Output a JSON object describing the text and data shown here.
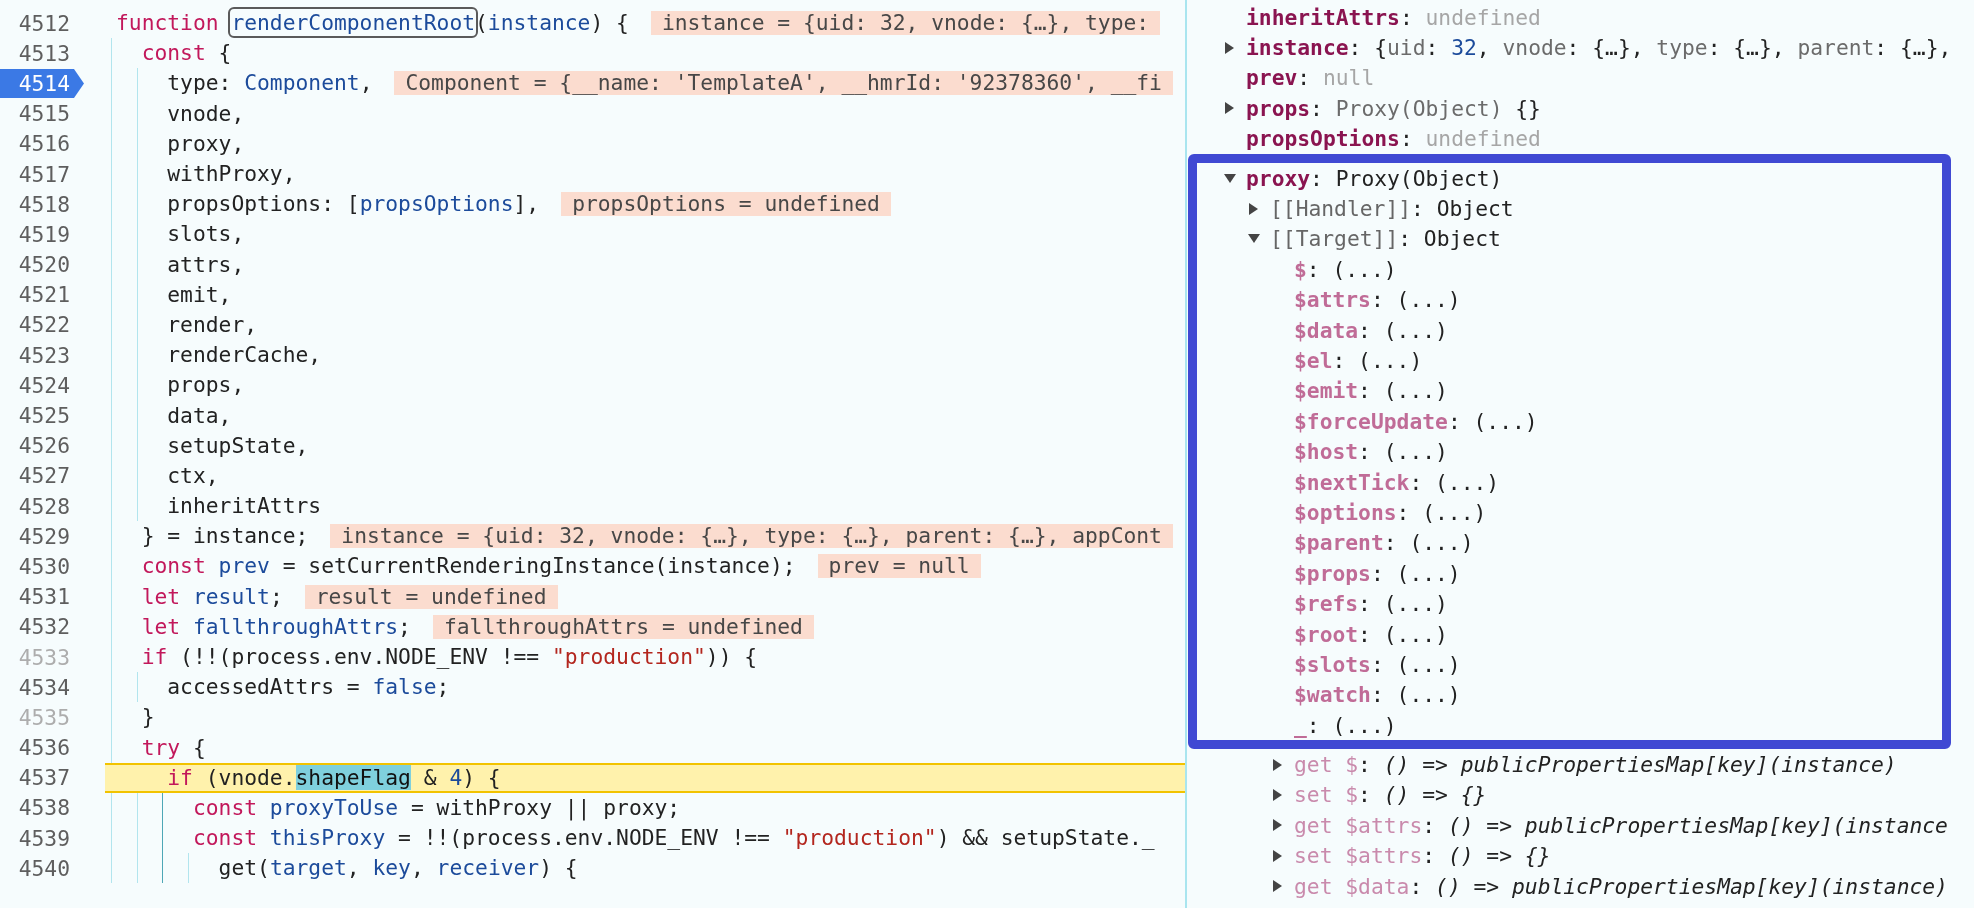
{
  "source": {
    "lines": [
      {
        "number": "4512",
        "breakpoint": false,
        "current": false,
        "dimmed": false,
        "tokens": [
          {
            "text": "function ",
            "kind": "keyword"
          },
          {
            "text": "renderComponentRoot",
            "kind": "outlined"
          },
          {
            "text": "(",
            "kind": "plain"
          },
          {
            "text": "instance",
            "kind": "ident"
          },
          {
            "text": ") {",
            "kind": "plain"
          }
        ],
        "value": "instance = {uid: 32, vnode: {…}, type:"
      },
      {
        "number": "4513",
        "breakpoint": false,
        "current": false,
        "dimmed": false,
        "tokens": [
          {
            "text": "  const",
            "kind": "keyword"
          },
          {
            "text": " {",
            "kind": "plain"
          }
        ]
      },
      {
        "number": "4514",
        "breakpoint": true,
        "current": false,
        "dimmed": false,
        "tokens": [
          {
            "text": "    type: ",
            "kind": "plain"
          },
          {
            "text": "Component",
            "kind": "ident"
          },
          {
            "text": ",",
            "kind": "plain"
          }
        ],
        "value": "Component = {__name: 'TemplateA', __hmrId: '92378360', __fi"
      },
      {
        "number": "4515",
        "breakpoint": false,
        "current": false,
        "dimmed": false,
        "tokens": [
          {
            "text": "    vnode,",
            "kind": "plain"
          }
        ]
      },
      {
        "number": "4516",
        "breakpoint": false,
        "current": false,
        "dimmed": false,
        "tokens": [
          {
            "text": "    proxy,",
            "kind": "plain"
          }
        ]
      },
      {
        "number": "4517",
        "breakpoint": false,
        "current": false,
        "dimmed": false,
        "tokens": [
          {
            "text": "    withProxy,",
            "kind": "plain"
          }
        ]
      },
      {
        "number": "4518",
        "breakpoint": false,
        "current": false,
        "dimmed": false,
        "tokens": [
          {
            "text": "    propsOptions: [",
            "kind": "plain"
          },
          {
            "text": "propsOptions",
            "kind": "ident"
          },
          {
            "text": "],",
            "kind": "plain"
          }
        ],
        "value": "propsOptions = undefined"
      },
      {
        "number": "4519",
        "breakpoint": false,
        "current": false,
        "dimmed": false,
        "tokens": [
          {
            "text": "    slots,",
            "kind": "plain"
          }
        ]
      },
      {
        "number": "4520",
        "breakpoint": false,
        "current": false,
        "dimmed": false,
        "tokens": [
          {
            "text": "    attrs,",
            "kind": "plain"
          }
        ]
      },
      {
        "number": "4521",
        "breakpoint": false,
        "current": false,
        "dimmed": false,
        "tokens": [
          {
            "text": "    emit,",
            "kind": "plain"
          }
        ]
      },
      {
        "number": "4522",
        "breakpoint": false,
        "current": false,
        "dimmed": false,
        "tokens": [
          {
            "text": "    render,",
            "kind": "plain"
          }
        ]
      },
      {
        "number": "4523",
        "breakpoint": false,
        "current": false,
        "dimmed": false,
        "tokens": [
          {
            "text": "    renderCache,",
            "kind": "plain"
          }
        ]
      },
      {
        "number": "4524",
        "breakpoint": false,
        "current": false,
        "dimmed": false,
        "tokens": [
          {
            "text": "    props,",
            "kind": "plain"
          }
        ]
      },
      {
        "number": "4525",
        "breakpoint": false,
        "current": false,
        "dimmed": false,
        "tokens": [
          {
            "text": "    data,",
            "kind": "plain"
          }
        ]
      },
      {
        "number": "4526",
        "breakpoint": false,
        "current": false,
        "dimmed": false,
        "tokens": [
          {
            "text": "    setupState,",
            "kind": "plain"
          }
        ]
      },
      {
        "number": "4527",
        "breakpoint": false,
        "current": false,
        "dimmed": false,
        "tokens": [
          {
            "text": "    ctx,",
            "kind": "plain"
          }
        ]
      },
      {
        "number": "4528",
        "breakpoint": false,
        "current": false,
        "dimmed": false,
        "tokens": [
          {
            "text": "    inheritAttrs",
            "kind": "plain"
          }
        ]
      },
      {
        "number": "4529",
        "breakpoint": false,
        "current": false,
        "dimmed": false,
        "tokens": [
          {
            "text": "  } = instance;",
            "kind": "plain"
          }
        ],
        "value": "instance = {uid: 32, vnode: {…}, type: {…}, parent: {…}, appCont"
      },
      {
        "number": "4530",
        "breakpoint": false,
        "current": false,
        "dimmed": false,
        "tokens": [
          {
            "text": "  const",
            "kind": "keyword"
          },
          {
            "text": " prev",
            "kind": "ident"
          },
          {
            "text": " = setCurrentRenderingInstance(instance);",
            "kind": "plain"
          }
        ],
        "value": "prev = null"
      },
      {
        "number": "4531",
        "breakpoint": false,
        "current": false,
        "dimmed": false,
        "tokens": [
          {
            "text": "  let",
            "kind": "keyword"
          },
          {
            "text": " result",
            "kind": "ident"
          },
          {
            "text": ";",
            "kind": "plain"
          }
        ],
        "value": "result = undefined"
      },
      {
        "number": "4532",
        "breakpoint": false,
        "current": false,
        "dimmed": false,
        "tokens": [
          {
            "text": "  let",
            "kind": "keyword"
          },
          {
            "text": " fallthroughAttrs",
            "kind": "ident"
          },
          {
            "text": ";",
            "kind": "plain"
          }
        ],
        "value": "fallthroughAttrs = undefined"
      },
      {
        "number": "4533",
        "breakpoint": false,
        "current": false,
        "dimmed": true,
        "tokens": [
          {
            "text": "  if",
            "kind": "keyword"
          },
          {
            "text": " (!!(process.env.NODE_ENV !== ",
            "kind": "plain"
          },
          {
            "text": "\"production\"",
            "kind": "string"
          },
          {
            "text": ")) {",
            "kind": "plain"
          }
        ]
      },
      {
        "number": "4534",
        "breakpoint": false,
        "current": false,
        "dimmed": false,
        "tokens": [
          {
            "text": "    accessedAttrs = ",
            "kind": "plain"
          },
          {
            "text": "false",
            "kind": "ident"
          },
          {
            "text": ";",
            "kind": "plain"
          }
        ]
      },
      {
        "number": "4535",
        "breakpoint": false,
        "current": false,
        "dimmed": true,
        "tokens": [
          {
            "text": "  }",
            "kind": "plain"
          }
        ]
      },
      {
        "number": "4536",
        "breakpoint": false,
        "current": false,
        "dimmed": false,
        "tokens": [
          {
            "text": "  try",
            "kind": "keyword"
          },
          {
            "text": " {",
            "kind": "plain"
          }
        ]
      },
      {
        "number": "4537",
        "breakpoint": false,
        "current": true,
        "dimmed": false,
        "tokens": [
          {
            "text": "    if",
            "kind": "keyword"
          },
          {
            "text": " (vnode.",
            "kind": "plain"
          },
          {
            "text": "shapeFlag",
            "kind": "match"
          },
          {
            "text": " & ",
            "kind": "plain"
          },
          {
            "text": "4",
            "kind": "number"
          },
          {
            "text": ") {",
            "kind": "plain"
          }
        ]
      },
      {
        "number": "4538",
        "breakpoint": false,
        "current": false,
        "dimmed": false,
        "tokens": [
          {
            "text": "      const",
            "kind": "keyword"
          },
          {
            "text": " proxyToUse",
            "kind": "ident"
          },
          {
            "text": " = withProxy || proxy;",
            "kind": "plain"
          }
        ]
      },
      {
        "number": "4539",
        "breakpoint": false,
        "current": false,
        "dimmed": false,
        "tokens": [
          {
            "text": "      const",
            "kind": "keyword"
          },
          {
            "text": " thisProxy",
            "kind": "ident"
          },
          {
            "text": " = !!(process.env.NODE_ENV !== ",
            "kind": "plain"
          },
          {
            "text": "\"production\"",
            "kind": "string"
          },
          {
            "text": ") && setupState._",
            "kind": "plain"
          }
        ]
      },
      {
        "number": "4540",
        "breakpoint": false,
        "current": false,
        "dimmed": false,
        "tokens": [
          {
            "text": "        get(",
            "kind": "plain"
          },
          {
            "text": "target",
            "kind": "ident"
          },
          {
            "text": ", ",
            "kind": "plain"
          },
          {
            "text": "key",
            "kind": "ident"
          },
          {
            "text": ", ",
            "kind": "plain"
          },
          {
            "text": "receiver",
            "kind": "ident"
          },
          {
            "text": ") {",
            "kind": "plain"
          }
        ]
      }
    ]
  },
  "scope": [
    {
      "name": "inheritAttrs",
      "kind": "own",
      "value": [
        {
          "text": ": ",
          "kind": "plain"
        },
        {
          "text": "undefined",
          "kind": "faint"
        }
      ]
    },
    {
      "name": "instance",
      "kind": "own",
      "expanded": false,
      "value": [
        {
          "text": ": {",
          "kind": "plain"
        },
        {
          "text": "uid",
          "kind": "muted"
        },
        {
          "text": ": ",
          "kind": "plain"
        },
        {
          "text": "32",
          "kind": "number"
        },
        {
          "text": ", ",
          "kind": "plain"
        },
        {
          "text": "vnode",
          "kind": "muted"
        },
        {
          "text": ": {…}, ",
          "kind": "plain"
        },
        {
          "text": "type",
          "kind": "muted"
        },
        {
          "text": ": {…}, ",
          "kind": "plain"
        },
        {
          "text": "parent",
          "kind": "muted"
        },
        {
          "text": ": {…},",
          "kind": "plain"
        }
      ]
    },
    {
      "name": "prev",
      "kind": "own",
      "value": [
        {
          "text": ": ",
          "kind": "plain"
        },
        {
          "text": "null",
          "kind": "faint"
        }
      ]
    },
    {
      "name": "props",
      "kind": "own",
      "expanded": false,
      "value": [
        {
          "text": ": ",
          "kind": "plain"
        },
        {
          "text": "Proxy(Object)",
          "kind": "muted"
        },
        {
          "text": " {}",
          "kind": "plain"
        }
      ]
    },
    {
      "name": "propsOptions",
      "kind": "own",
      "value": [
        {
          "text": ": ",
          "kind": "plain"
        },
        {
          "text": "undefined",
          "kind": "faint"
        }
      ]
    },
    {
      "name": "proxy",
      "kind": "own",
      "expanded": true,
      "frame_begins": true,
      "value": [
        {
          "text": ": Proxy(Object)",
          "kind": "plain"
        }
      ],
      "children": [
        {
          "name": "[[Handler]]",
          "kind": "internal",
          "expanded": false,
          "value": [
            {
              "text": ": Object",
              "kind": "plain"
            }
          ]
        },
        {
          "name": "[[Target]]",
          "kind": "internal",
          "expanded": true,
          "value": [
            {
              "text": ": Object",
              "kind": "plain"
            }
          ],
          "children": [
            {
              "name": "$",
              "kind": "synthetic",
              "value": [
                {
                  "text": ": (...)",
                  "kind": "plain"
                }
              ]
            },
            {
              "name": "$attrs",
              "kind": "synthetic",
              "value": [
                {
                  "text": ": (...)",
                  "kind": "plain"
                }
              ]
            },
            {
              "name": "$data",
              "kind": "synthetic",
              "value": [
                {
                  "text": ": (...)",
                  "kind": "plain"
                }
              ]
            },
            {
              "name": "$el",
              "kind": "synthetic",
              "value": [
                {
                  "text": ": (...)",
                  "kind": "plain"
                }
              ]
            },
            {
              "name": "$emit",
              "kind": "synthetic",
              "value": [
                {
                  "text": ": (...)",
                  "kind": "plain"
                }
              ]
            },
            {
              "name": "$forceUpdate",
              "kind": "synthetic",
              "value": [
                {
                  "text": ": (...)",
                  "kind": "plain"
                }
              ]
            },
            {
              "name": "$host",
              "kind": "synthetic",
              "value": [
                {
                  "text": ": (...)",
                  "kind": "plain"
                }
              ]
            },
            {
              "name": "$nextTick",
              "kind": "synthetic",
              "value": [
                {
                  "text": ": (...)",
                  "kind": "plain"
                }
              ]
            },
            {
              "name": "$options",
              "kind": "synthetic",
              "value": [
                {
                  "text": ": (...)",
                  "kind": "plain"
                }
              ]
            },
            {
              "name": "$parent",
              "kind": "synthetic",
              "value": [
                {
                  "text": ": (...)",
                  "kind": "plain"
                }
              ]
            },
            {
              "name": "$props",
              "kind": "synthetic",
              "value": [
                {
                  "text": ": (...)",
                  "kind": "plain"
                }
              ]
            },
            {
              "name": "$refs",
              "kind": "synthetic",
              "value": [
                {
                  "text": ": (...)",
                  "kind": "plain"
                }
              ]
            },
            {
              "name": "$root",
              "kind": "synthetic",
              "value": [
                {
                  "text": ": (...)",
                  "kind": "plain"
                }
              ]
            },
            {
              "name": "$slots",
              "kind": "synthetic",
              "value": [
                {
                  "text": ": (...)",
                  "kind": "plain"
                }
              ]
            },
            {
              "name": "$watch",
              "kind": "synthetic",
              "value": [
                {
                  "text": ": (...)",
                  "kind": "plain"
                }
              ]
            },
            {
              "name": "_",
              "kind": "synthetic",
              "frame_ends": true,
              "value": [
                {
                  "text": ": (...)",
                  "kind": "plain"
                }
              ]
            },
            {
              "name": "get $",
              "kind": "accessor",
              "expanded": false,
              "value": [
                {
                  "text": ": ",
                  "kind": "plain"
                },
                {
                  "text": "() => publicPropertiesMap[key](instance)",
                  "kind": "fn"
                }
              ]
            },
            {
              "name": "set $",
              "kind": "accessor",
              "expanded": false,
              "value": [
                {
                  "text": ": ",
                  "kind": "plain"
                },
                {
                  "text": "() => {}",
                  "kind": "fn"
                }
              ]
            },
            {
              "name": "get $attrs",
              "kind": "accessor",
              "expanded": false,
              "value": [
                {
                  "text": ": ",
                  "kind": "plain"
                },
                {
                  "text": "() => publicPropertiesMap[key](instance",
                  "kind": "fn"
                }
              ]
            },
            {
              "name": "set $attrs",
              "kind": "accessor",
              "expanded": false,
              "value": [
                {
                  "text": ": ",
                  "kind": "plain"
                },
                {
                  "text": "() => {}",
                  "kind": "fn"
                }
              ]
            },
            {
              "name": "get $data",
              "kind": "accessor",
              "expanded": false,
              "value": [
                {
                  "text": ": ",
                  "kind": "plain"
                },
                {
                  "text": "() => publicPropertiesMap[key](instance)",
                  "kind": "fn"
                }
              ]
            }
          ]
        }
      ]
    }
  ]
}
